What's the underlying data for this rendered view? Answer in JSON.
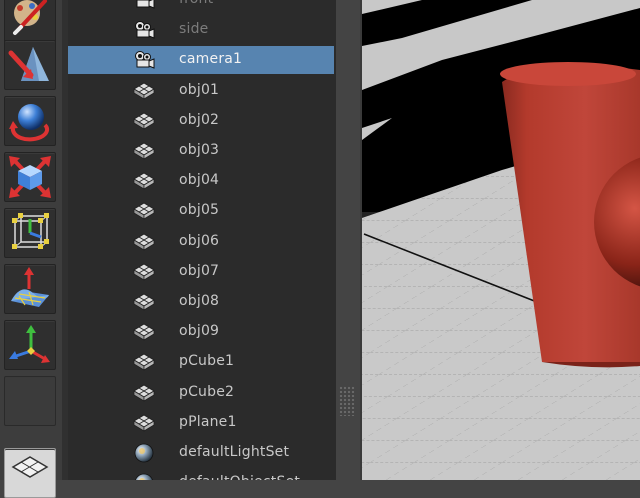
{
  "tool_shelf": {
    "tools": [
      {
        "icon": "paint-brush-icon"
      },
      {
        "icon": "soft-modification-icon"
      },
      {
        "icon": "rotate-icon"
      },
      {
        "icon": "scale-icon"
      },
      {
        "icon": "bounding-box-icon"
      },
      {
        "icon": "sculpt-tool-icon"
      },
      {
        "icon": "move-axis-icon"
      },
      {
        "icon": ""
      },
      {
        "icon": "poly-plane-icon"
      }
    ]
  },
  "outliner": {
    "selected_index": 2,
    "items": [
      {
        "label": "front",
        "icon": "camera-icon"
      },
      {
        "label": "side",
        "icon": "camera-icon"
      },
      {
        "label": "camera1",
        "icon": "camera-icon"
      },
      {
        "label": "obj01",
        "icon": "mesh-icon"
      },
      {
        "label": "obj02",
        "icon": "mesh-icon"
      },
      {
        "label": "obj03",
        "icon": "mesh-icon"
      },
      {
        "label": "obj04",
        "icon": "mesh-icon"
      },
      {
        "label": "obj05",
        "icon": "mesh-icon"
      },
      {
        "label": "obj06",
        "icon": "mesh-icon"
      },
      {
        "label": "obj07",
        "icon": "mesh-icon"
      },
      {
        "label": "obj08",
        "icon": "mesh-icon"
      },
      {
        "label": "obj09",
        "icon": "mesh-icon"
      },
      {
        "label": "pCube1",
        "icon": "mesh-icon"
      },
      {
        "label": "pCube2",
        "icon": "mesh-icon"
      },
      {
        "label": "pPlane1",
        "icon": "mesh-icon"
      },
      {
        "label": "defaultLightSet",
        "icon": "set-sphere-icon"
      },
      {
        "label": "defaultObjectSet",
        "icon": "set-sphere-icon"
      }
    ]
  },
  "viewport": {
    "object_color": "#b33a2c",
    "background_color": "#000000"
  }
}
